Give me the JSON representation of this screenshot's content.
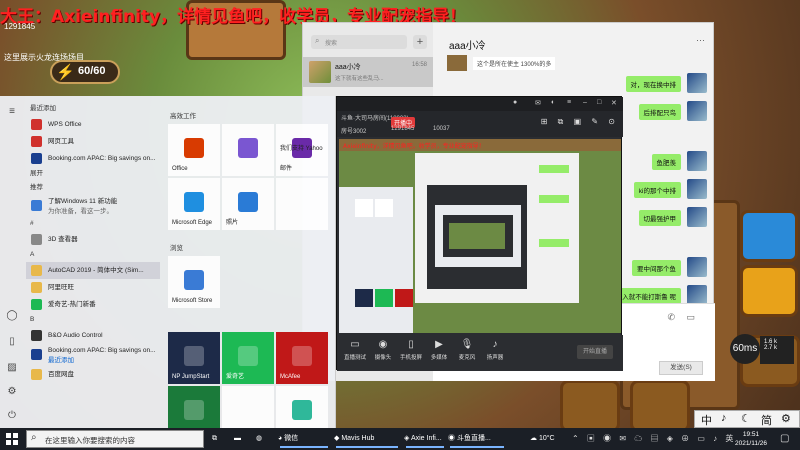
{
  "banner": {
    "text": "大王：Axieinfinity，详情见鱼吧，收学员，专业配宠指导！"
  },
  "game": {
    "id_text": "1291845",
    "score_text": "10037",
    "line_text": "这里展示火龙连场场目",
    "energy": "60/60"
  },
  "start_menu": {
    "rail_icons": [
      "hamburger-icon",
      "user-icon",
      "document-icon",
      "picture-icon",
      "settings-icon",
      "power-icon"
    ],
    "recent_header": "最近添加",
    "recent": [
      "WPS Office",
      "网页工具",
      "Booking.com APAC: Big savings on..."
    ],
    "expand_label": "展开",
    "suggest_header": "推荐",
    "suggest": [
      {
        "title": "了解Windows 11 新功能",
        "sub": "为你准备，看这一步。"
      }
    ],
    "hash_header": "#",
    "hash_items": [
      "3D 查看器"
    ],
    "a_header": "A",
    "a_items": [
      "AutoCAD 2019 - 简体中文 (Sim...",
      "阿里旺旺"
    ],
    "ai_items": [
      "爱奇艺-热门新番"
    ],
    "b_header": "B",
    "b_items": [
      "B&O Audio Control",
      "Booking.com APAC: Big savings on...",
      "百度网盘"
    ],
    "b_sub": "最近添加",
    "productivity_header": "高效工作",
    "tiles": [
      {
        "label": "Office",
        "icon": "office-icon",
        "color": "#d83b01"
      },
      {
        "label": "",
        "icon": "m365-icon",
        "color": "#7a56d1"
      },
      {
        "label": "我们支持 Yahoo",
        "sub": "邮件",
        "icon": "yahoo-icon",
        "color": "#fff"
      },
      {
        "label": "Microsoft Edge",
        "icon": "edge-icon",
        "color": "#1f8fe0"
      },
      {
        "label": "照片",
        "icon": "photos-icon",
        "color": "#2a7bd6"
      },
      {
        "label": "",
        "icon": "blank",
        "color": "#fff"
      }
    ],
    "browse_header": "浏览",
    "tiles2": [
      {
        "label": "Microsoft Store",
        "icon": "store-icon",
        "color": "#3a7bd5"
      }
    ],
    "tiles3": [
      {
        "label": "NP JumpStart",
        "icon": "jumpstart-icon",
        "color": "#1d2a48"
      },
      {
        "label": "爱奇艺",
        "icon": "iqiyi-icon",
        "color": "#1db954"
      },
      {
        "label": "McAfee",
        "icon": "mcafee-icon",
        "color": "#c01818"
      },
      {
        "label": "",
        "icon": "solitaire-icon",
        "color": "#1b7a3a"
      },
      {
        "label": "",
        "icon": "blank",
        "color": "#fff"
      },
      {
        "label": "",
        "icon": "s-icon",
        "color": "#2fb89a"
      }
    ]
  },
  "chat": {
    "search_placeholder": "搜索",
    "contact": {
      "name": "aaa小冷",
      "time": "16:58",
      "preview": "这下就有这些乱马..."
    },
    "title": "aaa小冷",
    "incoming_top": "这个是所在使主 1300%的多",
    "messages": [
      "对，现在换中排",
      "后排配只鸟",
      "鱼肥羡",
      "ki的那个中排",
      "切最强护甲",
      "要中间那个鱼",
      "加入就不能打斯鲁 呢"
    ],
    "send_label": "发送(S)"
  },
  "stream": {
    "title": "斗鱼直播伴侣",
    "room": "斗鱼·大司马房间(118003)",
    "live_badge": "开播中",
    "stat1": "房号3002",
    "stat2": "1291845",
    "stat3": "10037",
    "bottom": [
      {
        "icon": "screen-icon",
        "label": "直播测试"
      },
      {
        "icon": "camera-icon",
        "label": "摄像头"
      },
      {
        "icon": "phone-icon",
        "label": "手机投屏"
      },
      {
        "icon": "media-icon",
        "label": "多媒体"
      },
      {
        "icon": "mic-icon",
        "label": "麦克风"
      },
      {
        "icon": "speaker-icon",
        "label": "扬声器"
      }
    ],
    "start_label": "开始直播"
  },
  "net": {
    "ping": "60ms",
    "up": "1.6 k",
    "down": "2.7 k"
  },
  "ime": {
    "items": [
      "中",
      "♪",
      "☾",
      "简",
      "⚙"
    ]
  },
  "taskbar": {
    "search_placeholder": "在这里输入你要搜索的内容",
    "apps": [
      {
        "label": "",
        "icon": "task-view-icon"
      },
      {
        "label": "",
        "icon": "explorer-icon"
      },
      {
        "label": "",
        "icon": "edge-icon"
      },
      {
        "label": "微信",
        "icon": "wechat-icon"
      },
      {
        "label": "Mavis Hub",
        "icon": "mavis-icon"
      },
      {
        "label": "Axie Infi...",
        "icon": "axie-icon"
      },
      {
        "label": "斗鱼直播...",
        "icon": "douyu-icon"
      }
    ],
    "weather": "10°C",
    "time": "19:51",
    "date": "2021/11/26"
  },
  "colors": {
    "accent": "#0a64d0",
    "wechat_green": "#95ec69",
    "banner_red": "#ff2020"
  }
}
